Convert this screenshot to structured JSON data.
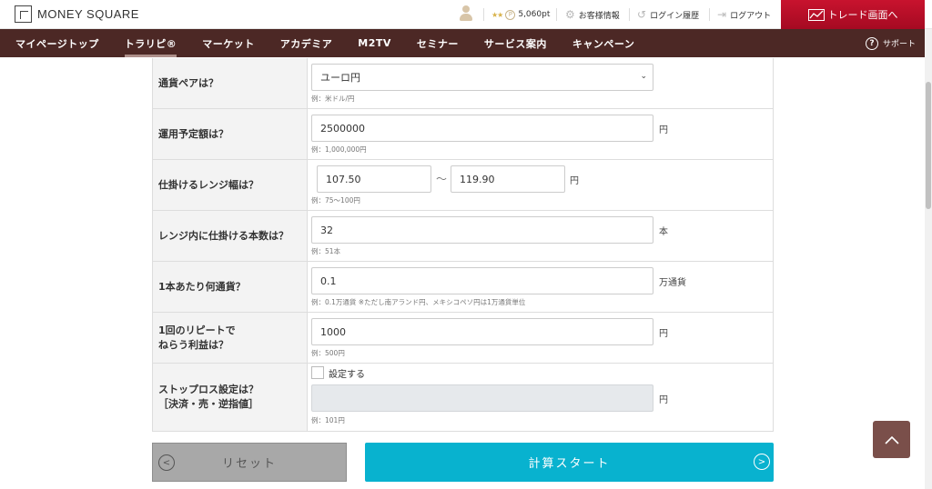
{
  "header": {
    "logo_text": "MONEY SQUARE",
    "points": "5,060pt",
    "customer_info": "お客様情報",
    "login_history": "ログイン履歴",
    "logout": "ログアウト",
    "trade_button": "トレード画面へ"
  },
  "nav": {
    "items": [
      {
        "label": "マイページトップ"
      },
      {
        "label": "トラリピ®"
      },
      {
        "label": "マーケット"
      },
      {
        "label": "アカデミア"
      },
      {
        "label": "M2TV"
      },
      {
        "label": "セミナー"
      },
      {
        "label": "サービス案内"
      },
      {
        "label": "キャンペーン"
      }
    ],
    "support": "サポート"
  },
  "form": {
    "rows": [
      {
        "label": "通貨ペアは？",
        "value": "ユーロ円",
        "hint": "例：米ドル/円"
      },
      {
        "label": "運用予定額は？",
        "value": "2500000",
        "unit": "円",
        "hint": "例：1,000,000円"
      },
      {
        "label": "仕掛けるレンジ幅は？",
        "value_low": "107.50",
        "separator": "〜",
        "value_high": "119.90",
        "unit": "円",
        "hint": "例：75〜100円"
      },
      {
        "label": "レンジ内に仕掛ける本数は？",
        "value": "32",
        "unit": "本",
        "hint": "例：51本"
      },
      {
        "label": "1本あたり何通貨？",
        "value": "0.1",
        "unit": "万通貨",
        "hint": "例：0.1万通貨 ※ただし南アランド円、メキシコペソ円は1万通貨単位"
      },
      {
        "label_line1": "1回のリピートで",
        "label_line2": "ねらう利益は？",
        "value": "1000",
        "unit": "円",
        "hint": "例：500円"
      },
      {
        "label_line1": "ストップロス設定は？",
        "label_line2": "［決済・売・逆指値］",
        "checkbox_label": "設定する",
        "value": "",
        "unit": "円",
        "hint": "例：101円"
      }
    ]
  },
  "buttons": {
    "reset": "リセット",
    "calculate": "計算スタート"
  },
  "colors": {
    "nav_bg": "#4c2825",
    "trade_red": "#c8132e",
    "calc_blue": "#08b2cf",
    "reset_gray": "#a8a8a8",
    "totop_brown": "#7a4f4a"
  }
}
